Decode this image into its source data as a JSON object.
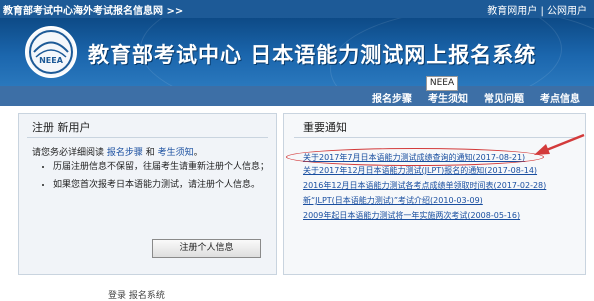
{
  "topbar": {
    "site_name": "教育部考试中心海外考试报名信息网 >>",
    "link_edu": "教育网用户",
    "divider": "|",
    "link_public": "公网用户"
  },
  "banner": {
    "title": "教育部考试中心  日本语能力测试网上报名系统",
    "logo_text": "NEEA",
    "tooltip": "NEEA"
  },
  "nav": {
    "items": [
      "报名步骤",
      "考生须知",
      "常见问题",
      "考点信息"
    ]
  },
  "register_panel": {
    "heading": "注册 新用户",
    "intro_prefix": "请您务必详细阅读",
    "link_steps": "报名步骤",
    "intro_and": "和",
    "link_notice": "考生须知",
    "intro_suffix": "。",
    "rules": [
      "历届注册信息不保留，往届考生请重新注册个人信息；",
      "如果您首次报考日本语能力测试，请注册个人信息。"
    ],
    "button_label": "注册个人信息"
  },
  "notices_panel": {
    "heading": "重要通知",
    "items": [
      "关于2017年7月日本语能力测试成绩查询的通知(2017-08-21)",
      "关于2017年12月日本语能力测试(JLPT)报名的通知(2017-08-14)",
      "2016年12月日本语能力测试各考点成绩单领取时间表(2017-02-28)",
      "新“JLPT(日本语能力测试)”考试介绍(2010-03-09)",
      "2009年起日本语能力测试将一年实施两次考试(2008-05-16)"
    ]
  },
  "footer_partial": "登录 报名系统",
  "colors": {
    "topbar": "#1d5a97",
    "navbar": "#3d6fa6",
    "link": "#1a4fa0",
    "highlight": "#d33b3b"
  }
}
